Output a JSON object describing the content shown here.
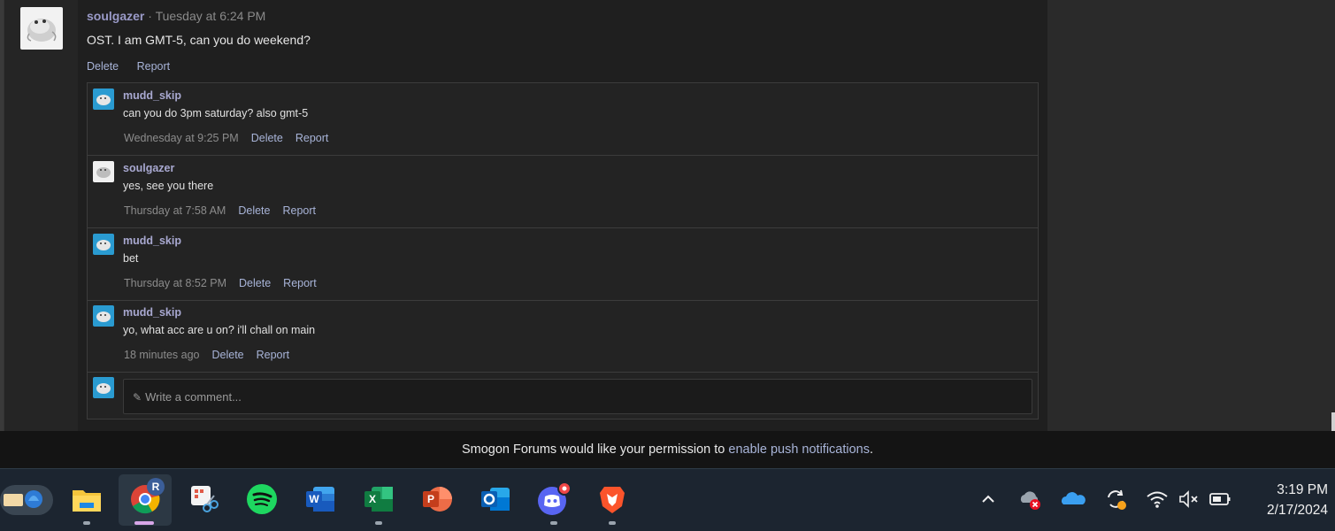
{
  "post": {
    "username": "soulgazer",
    "separator": " · ",
    "timestamp": "Tuesday at 6:24 PM",
    "body": "OST. I am GMT-5, can you do weekend?",
    "actions": [
      "Delete",
      "Report"
    ]
  },
  "comments": [
    {
      "username": "mudd_skip",
      "text": "can you do 3pm saturday? also gmt-5",
      "timestamp": "Wednesday at 9:25 PM",
      "delete": "Delete",
      "report": "Report"
    },
    {
      "username": "soulgazer",
      "text": "yes, see you there",
      "timestamp": "Thursday at 7:58 AM",
      "delete": "Delete",
      "report": "Report"
    },
    {
      "username": "mudd_skip",
      "text": "bet",
      "timestamp": "Thursday at 8:52 PM",
      "delete": "Delete",
      "report": "Report"
    },
    {
      "username": "mudd_skip",
      "text": "yo, what acc are u on? i'll chall on main",
      "timestamp": "18 minutes ago",
      "delete": "Delete",
      "report": "Report"
    }
  ],
  "composer": {
    "placeholder": "Write a comment..."
  },
  "notice": {
    "text": "Smogon Forums would like your permission to ",
    "link": "enable push notifications",
    "end": "."
  },
  "taskbar": {
    "apps": [
      "widgets-icon",
      "file-explorer-icon",
      "chrome-icon",
      "snipping-tool-icon",
      "spotify-icon",
      "word-icon",
      "excel-icon",
      "powerpoint-icon",
      "outlook-icon",
      "discord-icon",
      "brave-icon"
    ],
    "chrome_badge": "R",
    "clock_time": "3:19 PM",
    "clock_date": "2/17/2024"
  },
  "colors": {
    "username": "#a8a8d0",
    "link": "#a8b4d8",
    "avatar_blue": "#2a9bd1"
  }
}
